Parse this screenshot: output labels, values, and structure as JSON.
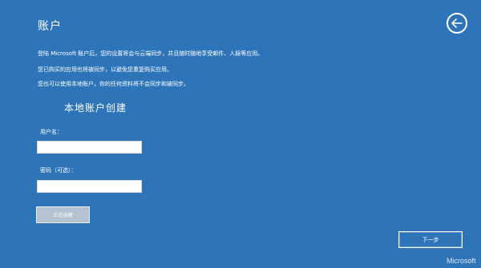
{
  "page": {
    "title": "账户",
    "brand": "Microsoft"
  },
  "description": {
    "line1": "登陆 Microsoft 账户后，您的设置将会与云端同步，并且随时随地享受邮件、人脉等应用。",
    "line2": "您已购买的应用也将被同步，以避免您重复购买应用。",
    "line3": "您也可以使用本地账户，你的任何资料将不会同步和被同步。"
  },
  "form": {
    "heading": "本地账户创建",
    "username_label": "用户名：",
    "username_value": "",
    "password_label": "密码（可选）：",
    "password_value": "",
    "action_label": "正在创建"
  },
  "nav": {
    "next_label": "下一步",
    "back_icon": "arrow-left-circle-icon"
  },
  "colors": {
    "background": "#2e74b8",
    "text": "#ffffff",
    "disabled_button": "#b4c2d1"
  }
}
